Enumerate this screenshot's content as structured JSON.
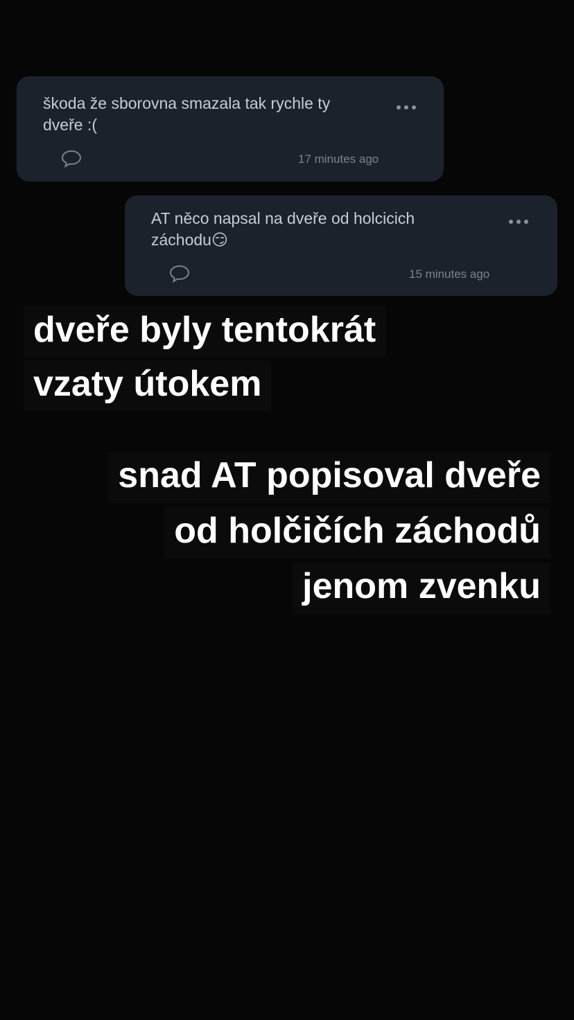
{
  "comments": [
    {
      "text": "škoda že sborovna smazala tak rychle ty\ndveře :(",
      "time": "17 minutes ago",
      "reply_icon": "speech-bubble-icon",
      "menu_icon": "more-dots-icon"
    },
    {
      "text": "AT něco napsal na dveře od holcicich\nzáchodu😏",
      "time": "15 minutes ago",
      "reply_icon": "speech-bubble-icon",
      "menu_icon": "more-dots-icon"
    }
  ],
  "captions": [
    "dveře byly tentokrát",
    "vzaty útokem",
    "snad AT popisoval dveře",
    "od holčičích záchodů",
    "jenom zvenku"
  ],
  "colors": {
    "background": "#060606",
    "card": "#1c222c",
    "card_text": "#c8ccd3",
    "meta_text": "#7d838d",
    "caption_text": "#ffffff"
  }
}
